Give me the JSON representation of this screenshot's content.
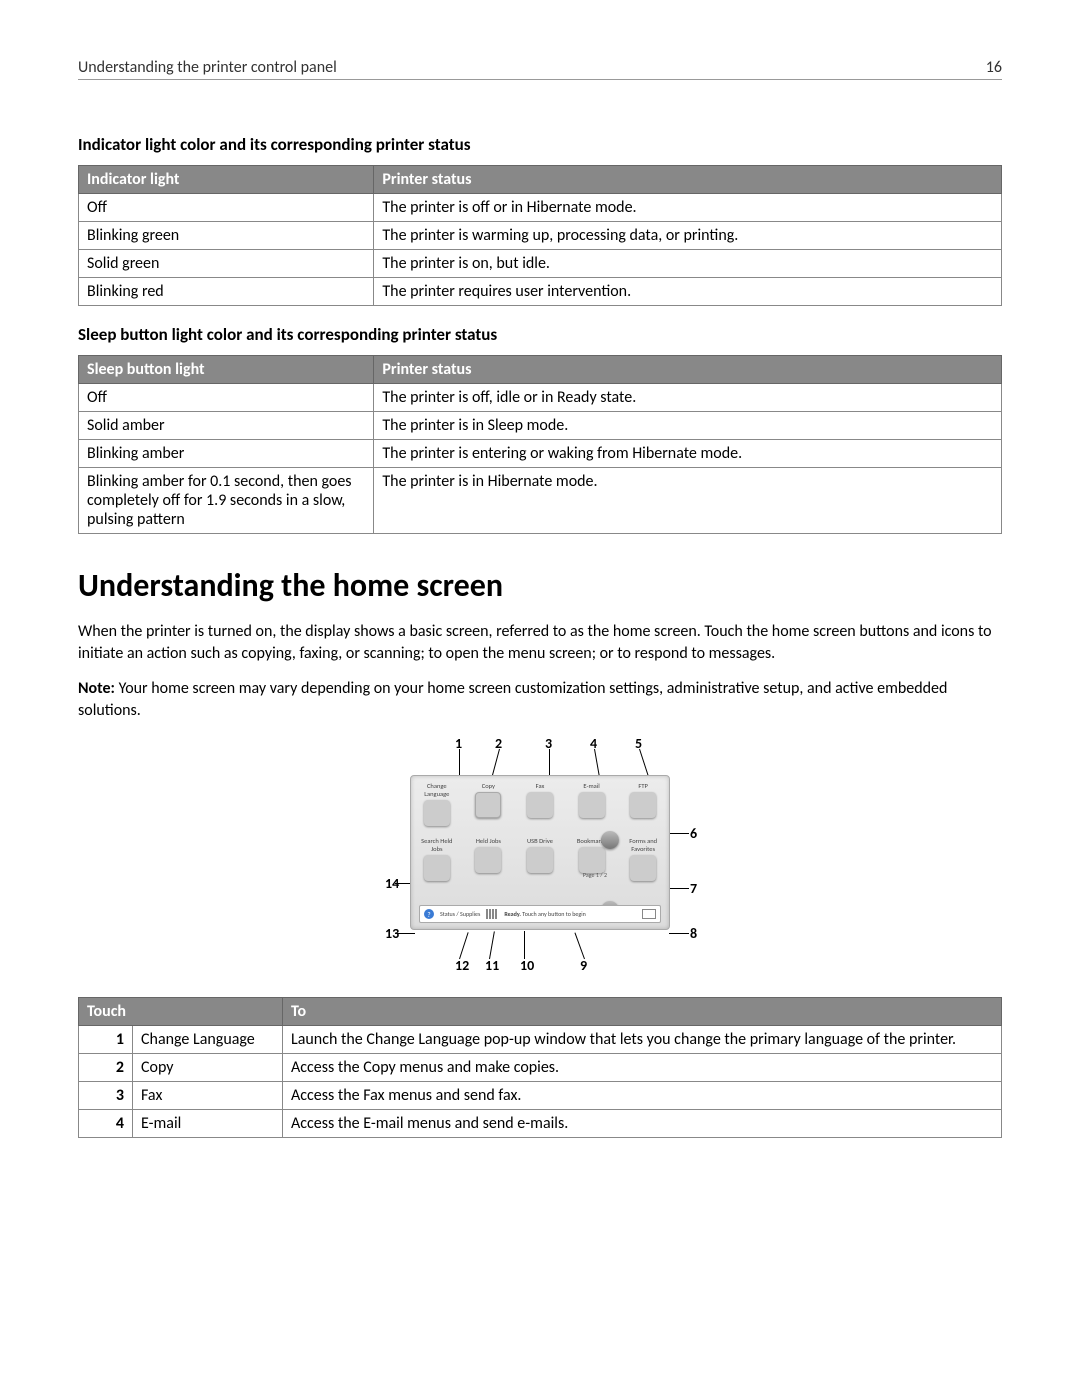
{
  "header": {
    "title": "Understanding the printer control panel",
    "page": "16"
  },
  "section1": {
    "heading": "Indicator light color and its corresponding printer status",
    "col1": "Indicator light",
    "col2": "Printer status",
    "rows": [
      {
        "a": "Off",
        "b": "The printer is off or in Hibernate mode."
      },
      {
        "a": "Blinking green",
        "b": "The printer is warming up, processing data, or printing."
      },
      {
        "a": "Solid green",
        "b": "The printer is on, but idle."
      },
      {
        "a": "Blinking red",
        "b": "The printer requires user intervention."
      }
    ]
  },
  "section2": {
    "heading": "Sleep button light color and its corresponding printer status",
    "col1": "Sleep button light",
    "col2": "Printer status",
    "rows": [
      {
        "a": "Off",
        "b": "The printer is off, idle or in Ready state."
      },
      {
        "a": "Solid amber",
        "b": "The printer is in Sleep mode."
      },
      {
        "a": "Blinking amber",
        "b": "The printer is entering or waking from Hibernate mode."
      },
      {
        "a": "Blinking amber for 0.1 second, then goes completely off for 1.9 seconds in a slow, pulsing pattern",
        "b": "The printer is in Hibernate mode."
      }
    ]
  },
  "home": {
    "title": "Understanding the home screen",
    "para1": "When the printer is turned on, the display shows a basic screen, referred to as the home screen. Touch the home screen buttons and icons to initiate an action such as copying, faxing, or scanning; to open the menu screen; or to respond to messages.",
    "note_label": "Note:",
    "note_text": " Your home screen may vary depending on your home screen customization settings, administrative setup, and active embedded solutions."
  },
  "screen": {
    "row1": [
      "Change Language",
      "Copy",
      "Fax",
      "E-mail",
      "FTP"
    ],
    "row2": [
      "Search Held Jobs",
      "Held Jobs",
      "USB Drive",
      "Bookmarks",
      "Forms and Favorites"
    ],
    "page_label": "Page 1 / 2",
    "status_left": "Status / Supplies",
    "status_ready": "Ready.",
    "status_hint": "Touch any button to begin"
  },
  "callouts": [
    "1",
    "2",
    "3",
    "4",
    "5",
    "6",
    "7",
    "8",
    "9",
    "10",
    "11",
    "12",
    "13",
    "14"
  ],
  "touch": {
    "col1": "Touch",
    "col2": "To",
    "rows": [
      {
        "n": "1",
        "name": "Change Language",
        "to": "Launch the Change Language pop-up window that lets you change the primary language of the printer."
      },
      {
        "n": "2",
        "name": "Copy",
        "to": "Access the Copy menus and make copies."
      },
      {
        "n": "3",
        "name": "Fax",
        "to": "Access the Fax menus and send fax."
      },
      {
        "n": "4",
        "name": "E-mail",
        "to": "Access the E-mail menus and send e-mails."
      }
    ]
  }
}
